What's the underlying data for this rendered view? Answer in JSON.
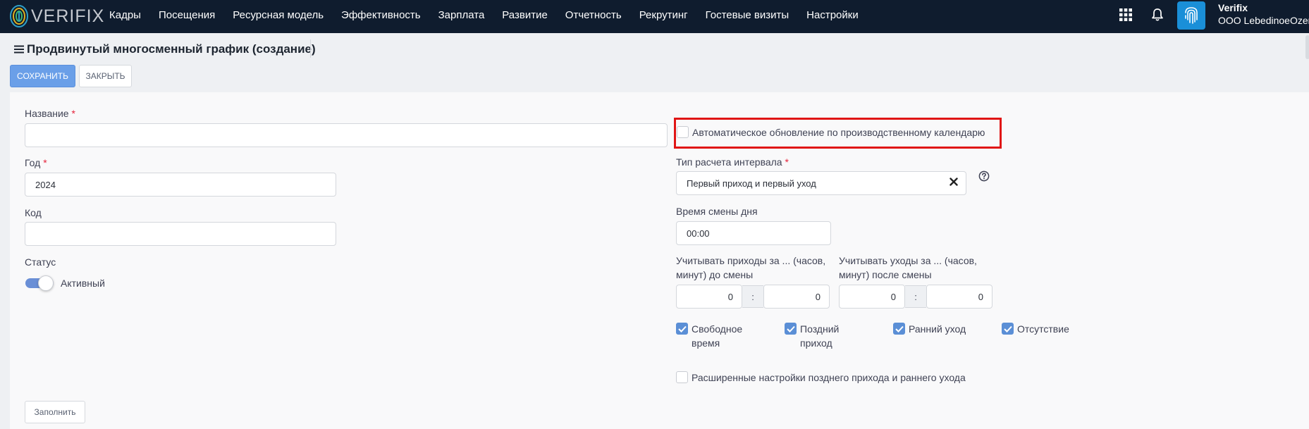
{
  "app": {
    "brand": "VERIFIX",
    "user_name": "Verifix",
    "user_org": "ООО LebedinoeOzero",
    "accent": "#6a9fe8"
  },
  "nav": {
    "items": [
      "Кадры",
      "Посещения",
      "Ресурсная модель",
      "Эффективность",
      "Зарплата",
      "Развитие",
      "Отчетность",
      "Рекрутинг",
      "Гостевые визиты",
      "Настройки"
    ]
  },
  "page": {
    "title": "Продвинутый многосменный график (создание)",
    "save_label": "СОХРАНИТЬ",
    "close_label": "ЗАКРЫТЬ"
  },
  "form": {
    "name_label": "Название",
    "name_value": "",
    "year_label": "Год",
    "year_value": "2024",
    "code_label": "Код",
    "code_value": "",
    "status_label": "Статус",
    "status_value": "Активный",
    "status_on": true,
    "fill_label": "Заполнить",
    "required_mark": "*",
    "auto_update_label": "Автоматическое обновление по производственному календарю",
    "auto_update_checked": false,
    "interval_label": "Тип расчета интервала",
    "interval_value": "Первый приход и первый уход",
    "day_change_label": "Время смены дня",
    "day_change_value": "00:00",
    "arrivals_label_1": "Учитывать приходы за ... (часов,",
    "arrivals_label_2": "минут) до смены",
    "arrivals_hours": "0",
    "arrivals_minutes": "0",
    "departures_label_1": "Учитывать уходы за ... (часов,",
    "departures_label_2": "минут) после смены",
    "departures_hours": "0",
    "departures_minutes": "0",
    "separator": ":",
    "checks": [
      {
        "label_1": "Свободное",
        "label_2": "время",
        "checked": true
      },
      {
        "label_1": "Поздний",
        "label_2": "приход",
        "checked": true
      },
      {
        "label_1": "Ранний уход",
        "label_2": "",
        "checked": true
      },
      {
        "label_1": "Отсутствие",
        "label_2": "",
        "checked": true
      }
    ],
    "extended_label": "Расширенные настройки позднего прихода и раннего ухода",
    "extended_checked": false
  }
}
